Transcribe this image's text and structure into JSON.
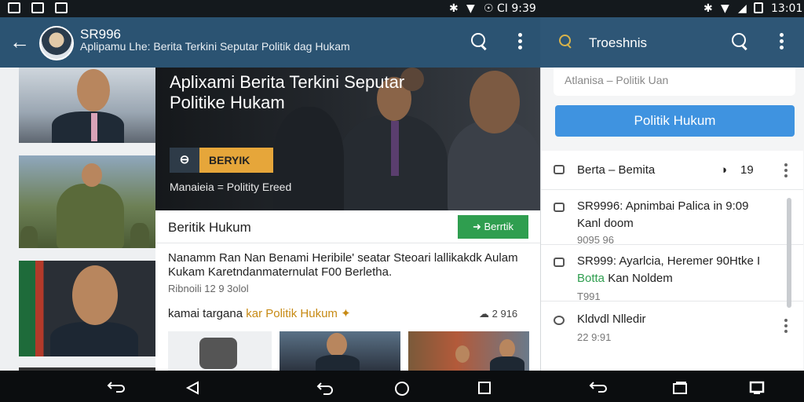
{
  "status_bar": {
    "left_icons": [
      "image-icon",
      "image-icon",
      "image-icon"
    ],
    "center_text": "☉ CI 9:39",
    "right_text": "13:01"
  },
  "app_bar": {
    "title": "SR996",
    "subtitle": "Aplipamu Lhe: Berita Terkini Seputar Politik dag Hukam",
    "right_title": "Troeshnis"
  },
  "hero": {
    "title": "Aplixami Berita Terkini Seputar Politike Hukam",
    "button_label": "BERYIK",
    "caption": "Manaieia = Politity Ereed"
  },
  "article": {
    "header": "Beritik Hukum",
    "button_label": "Berrtik",
    "body": "Nanamm Ran Nan Benami Heribile' seatar Steoari lallikakdk Aulam Kukam Karetndanmaternulat F00 Berletha.",
    "meta": "Ribnoili 12 9 3olol",
    "tagline_prefix": "kamai targana",
    "tagline_accent": "kar Politik Hukum",
    "comments": "2 916"
  },
  "right_panel": {
    "input_placeholder": "Atlanisa – Politik Uan",
    "button_label": "Politik Hukum",
    "list": [
      {
        "title": "Berta – Bemita",
        "count": "19"
      },
      {
        "title": "SR9996: Apnimbai Palica in 9:09",
        "title2": "Kanl doom",
        "meta": "9095 96"
      },
      {
        "title": "SR999: Ayarlcia, Heremer 90Htke I",
        "title2_accent": "Botta",
        "title2_rest": "Kan Noldem",
        "meta": "T991"
      },
      {
        "title": "Kldvdl Nlledir",
        "meta": "22 9:91"
      }
    ]
  },
  "colors": {
    "app_bar": "#2b5372",
    "accent_orange": "#e6a63a",
    "accent_green": "#2f9e4f",
    "accent_blue": "#3f93e0"
  }
}
